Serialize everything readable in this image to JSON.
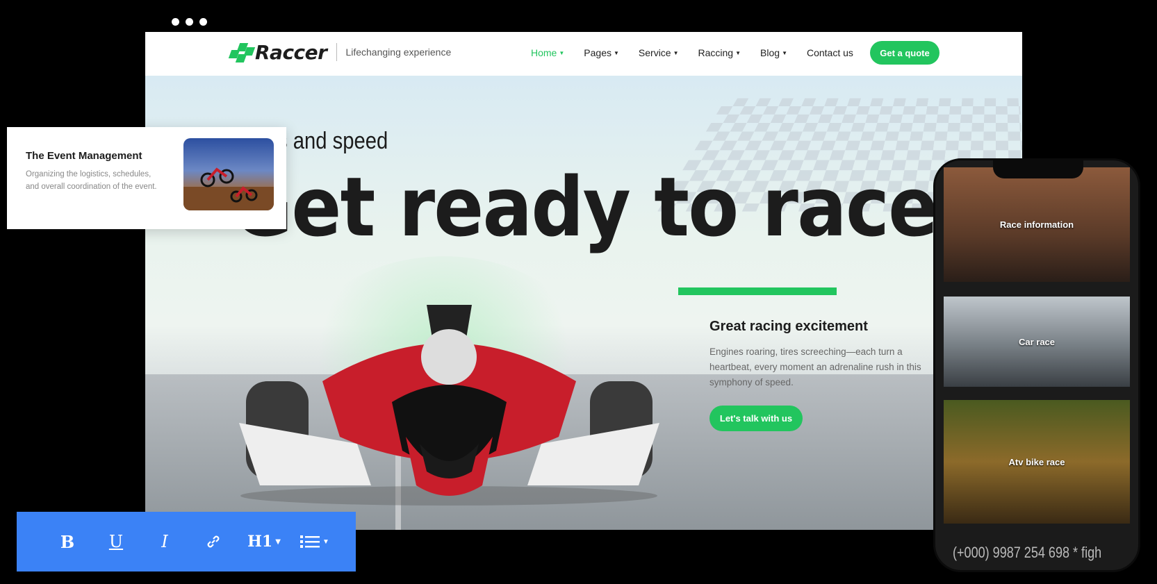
{
  "nav": {
    "logo_text": "Raccer",
    "tagline": "Lifechanging experience",
    "items": [
      {
        "label": "Home",
        "active": true
      },
      {
        "label": "Pages"
      },
      {
        "label": "Service"
      },
      {
        "label": "Raccing"
      },
      {
        "label": "Blog"
      },
      {
        "label": "Contact us"
      }
    ],
    "cta": "Get a quote"
  },
  "hero": {
    "subtitle": "Thrills and speed",
    "subtitle_visible": "s and speed",
    "headline": "Get ready to race",
    "info_title": "Great racing excitement",
    "info_text": "Engines roaring, tires screeching—each turn a heartbeat, every moment an adrenaline rush in this symphony of speed.",
    "info_button": "Let's talk with us"
  },
  "event_card": {
    "title": "The Event Management",
    "text": "Organizing the logistics, schedules, and overall coordination of the event."
  },
  "toolbar": {
    "bold": "B",
    "underline": "U",
    "italic": "I",
    "heading": "H1"
  },
  "phone": {
    "cards": [
      {
        "label": "Race information"
      },
      {
        "label": "Car race"
      },
      {
        "label": "Atv bike race"
      }
    ],
    "footer": "(+000) 9987 254 698   *   figh"
  },
  "colors": {
    "accent": "#22c55e",
    "toolbar": "#3b82f6",
    "car_red": "#c81e2b"
  }
}
